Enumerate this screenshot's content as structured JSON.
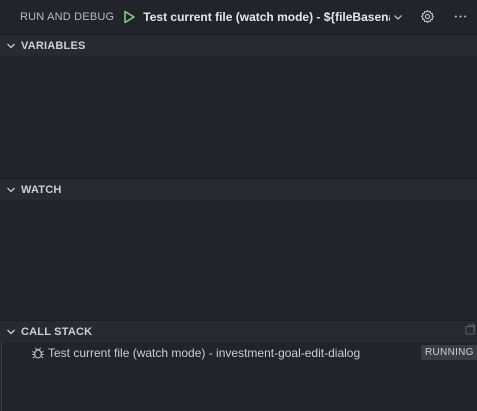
{
  "toolbar": {
    "title": "RUN AND DEBUG",
    "config_label": "Test current file (watch mode) - ${fileBasename}",
    "start_icon": "play-icon",
    "settings_icon": "gear-icon",
    "more_icon": "more-icon"
  },
  "sections": {
    "variables": {
      "title": "VARIABLES"
    },
    "watch": {
      "title": "WATCH"
    },
    "call_stack": {
      "title": "CALL STACK"
    }
  },
  "call_stack": {
    "items": [
      {
        "icon": "bug-icon",
        "label": "Test current file (watch mode) - investment-goal-edit-dialog",
        "status": "RUNNING"
      }
    ]
  },
  "colors": {
    "background": "#21252b",
    "header": "#272b31",
    "play": "#89d185",
    "badge": "#3a3d41"
  }
}
